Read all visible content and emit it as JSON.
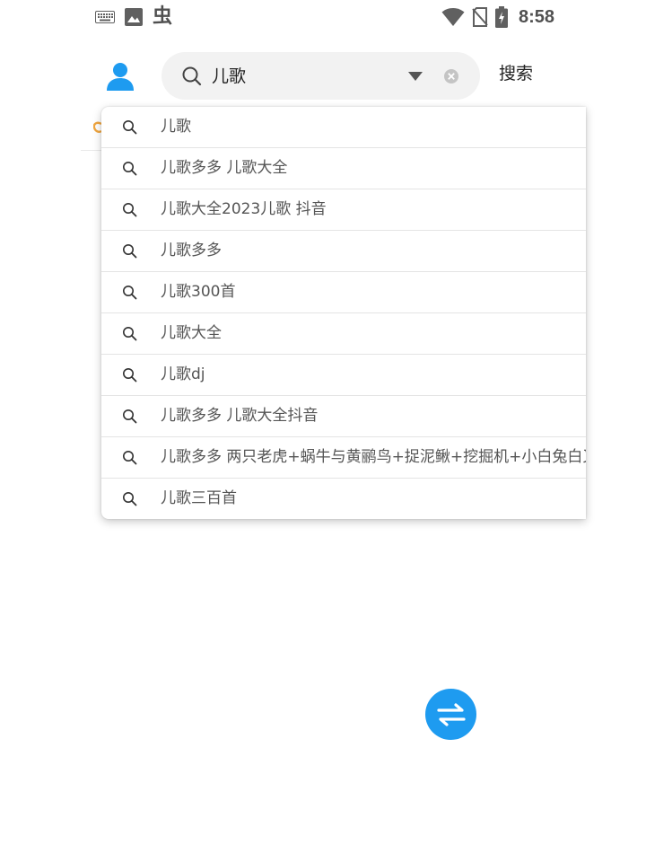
{
  "status_bar": {
    "time": "8:58",
    "app_glyph": "虫",
    "icons": [
      "keyboard-icon",
      "image-icon",
      "wifi-icon",
      "no-sim-icon",
      "battery-charging-icon"
    ]
  },
  "header": {
    "search_query": "儿歌",
    "search_button_label": "搜索",
    "icons": [
      "avatar-icon",
      "search-icon",
      "dropdown-arrow-icon",
      "clear-icon"
    ]
  },
  "suggestions": [
    {
      "label": "儿歌"
    },
    {
      "label": "儿歌多多 儿歌大全"
    },
    {
      "label": "儿歌大全2023儿歌 抖音"
    },
    {
      "label": "儿歌多多"
    },
    {
      "label": "儿歌300首"
    },
    {
      "label": "儿歌大全"
    },
    {
      "label": "儿歌dj"
    },
    {
      "label": "儿歌多多 儿歌大全抖音"
    },
    {
      "label": "儿歌多多 两只老虎+蜗牛与黄鹂鸟+捉泥鳅+挖掘机+小白兔白又白"
    },
    {
      "label": "儿歌三百首"
    }
  ],
  "fab": {
    "icon": "swap-icon"
  },
  "colors": {
    "accent": "#1e9bf0",
    "search_bg": "#f2f2f2",
    "text_primary": "#222222",
    "text_secondary": "#555555",
    "divider": "#e4e4e4",
    "tab_peek": "#f0a640"
  }
}
